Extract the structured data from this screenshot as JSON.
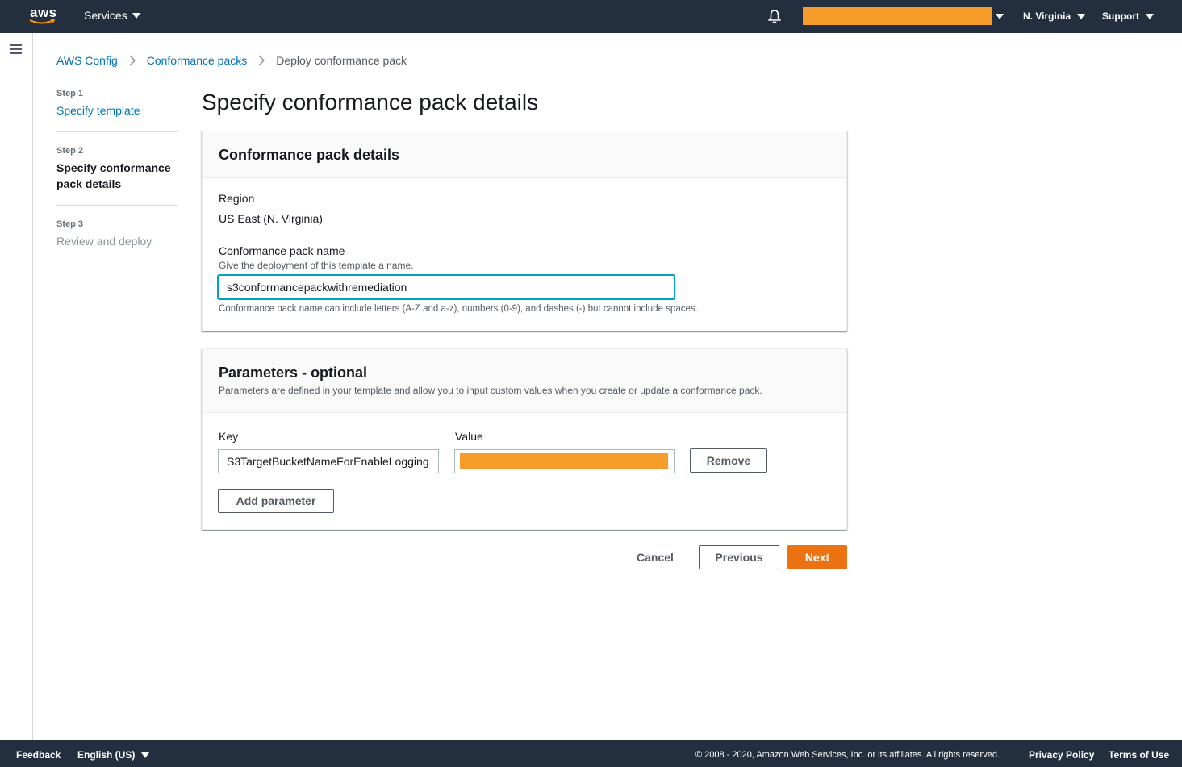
{
  "topnav": {
    "logo_text": "aws",
    "services_label": "Services",
    "region_label": "N. Virginia",
    "support_label": "Support",
    "redaction_color": "#f59c2a"
  },
  "breadcrumb": {
    "items": [
      "AWS Config",
      "Conformance packs",
      "Deploy conformance pack"
    ]
  },
  "steps": [
    {
      "number": "Step 1",
      "title": "Specify template",
      "state": "link"
    },
    {
      "number": "Step 2",
      "title": "Specify conformance pack details",
      "state": "active"
    },
    {
      "number": "Step 3",
      "title": "Review and deploy",
      "state": "disabled"
    }
  ],
  "page_title": "Specify conformance pack details",
  "details_panel": {
    "title": "Conformance pack details",
    "region_label": "Region",
    "region_value": "US East (N. Virginia)",
    "name_label": "Conformance pack name",
    "name_description": "Give the deployment of this template a name.",
    "name_value": "s3conformancepackwithremediation",
    "name_constraint": "Conformance pack name can include letters (A-Z and a-z), numbers (0-9), and dashes (-) but cannot include spaces."
  },
  "params_panel": {
    "title": "Parameters - optional",
    "description": "Parameters are defined in your template and allow you to input custom values when you create or update a conformance pack.",
    "key_label": "Key",
    "value_label": "Value",
    "key_value": "S3TargetBucketNameForEnableLogging",
    "remove_label": "Remove",
    "add_label": "Add parameter"
  },
  "actions": {
    "cancel": "Cancel",
    "previous": "Previous",
    "next": "Next",
    "primary_color": "#ec7211"
  },
  "footer": {
    "feedback": "Feedback",
    "language": "English (US)",
    "copyright": "© 2008 - 2020, Amazon Web Services, Inc. or its affiliates. All rights reserved.",
    "privacy": "Privacy Policy",
    "terms": "Terms of Use"
  }
}
